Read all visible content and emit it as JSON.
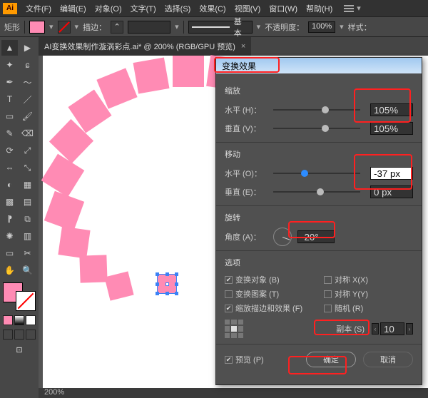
{
  "menu": {
    "items": [
      "文件(F)",
      "编辑(E)",
      "对象(O)",
      "文字(T)",
      "选择(S)",
      "效果(C)",
      "视图(V)",
      "窗口(W)",
      "帮助(H)"
    ]
  },
  "options": {
    "shapeLabel": "矩形",
    "strokeLabel": "描边：",
    "basicLabel": "基本",
    "opacityLabel": "不透明度：",
    "opacityValue": "100%",
    "styleLabel": "样式："
  },
  "document": {
    "tab": "AI变换效果制作漩涡彩点.ai* @ 200% (RGB/GPU 预览)",
    "zoom": "200%"
  },
  "dialog": {
    "title": "变换效果",
    "scale": {
      "title": "缩放",
      "hLabel": "水平 (H)：",
      "hValue": "105%",
      "vLabel": "垂直 (V)：",
      "vValue": "105%",
      "hKnob": 56,
      "vKnob": 56
    },
    "move": {
      "title": "移动",
      "hLabel": "水平 (O)：",
      "hValue": "-37 px",
      "vLabel": "垂直 (E)：",
      "vValue": "0 px",
      "hKnob": 32,
      "vKnob": 50
    },
    "rotate": {
      "title": "旋转",
      "aLabel": "角度 (A)：",
      "aValue": "-20°"
    },
    "options": {
      "title": "选项",
      "transformObjects": "变换对象 (B)",
      "reflectX": "对称 X(X)",
      "transformPatterns": "变换图案 (T)",
      "reflectY": "对称 Y(Y)",
      "scaleStrokes": "缩放描边和效果 (F)",
      "random": "随机 (R)"
    },
    "copies": {
      "label": "副本 (S)",
      "value": "10"
    },
    "preview": "预览 (P)",
    "ok": "确定",
    "cancel": "取消"
  }
}
